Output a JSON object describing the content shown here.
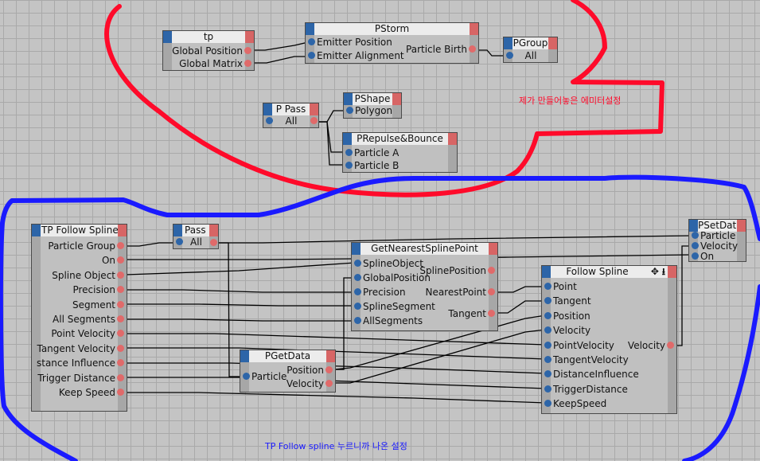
{
  "annotations": {
    "red_note": "제가 만들어놓은 에미터설정",
    "blue_note": "TP Follow spline 누르니까 나온 설정",
    "red_color": "#ff0a2a",
    "blue_color": "#1a1aff"
  },
  "colors": {
    "input_port": "#2d65a8",
    "output_port": "#e06a6a",
    "title_bg": "#ececec",
    "node_bg": "#c0c0c0",
    "canvas_bg": "#c4c4c4"
  },
  "nodes": {
    "tp": {
      "title": "tp",
      "outputs": [
        "Global Position",
        "Global Matrix"
      ]
    },
    "pstorm": {
      "title": "PStorm",
      "inputs": [
        "Emitter Position",
        "Emitter Alignment"
      ],
      "outputs": [
        "Particle Birth"
      ]
    },
    "pgroup": {
      "title": "PGroup",
      "inputs": [
        "All"
      ]
    },
    "ppass1": {
      "title": "P Pass",
      "inputs": [
        "All"
      ]
    },
    "pshape": {
      "title": "PShape",
      "inputs": [
        "Polygon"
      ]
    },
    "prepulse": {
      "title": "PRepulse&Bounce",
      "inputs": [
        "Particle A",
        "Particle B"
      ]
    },
    "tpfollow": {
      "title": "TP Follow Spline",
      "outputs": [
        "Particle Group",
        "On",
        "Spline Object",
        "Precision",
        "Segment",
        "All Segments",
        "Point Velocity",
        "Tangent Velocity",
        "stance Influence",
        "Trigger Distance",
        "Keep Speed"
      ]
    },
    "ppass2": {
      "title": "P Pass",
      "inputs": [
        "All"
      ]
    },
    "getnearest": {
      "title": "GetNearestSplinePoint",
      "inputs": [
        "SplineObject",
        "GlobalPosition",
        "Precision",
        "SplineSegment",
        "AllSegments"
      ],
      "outputs": [
        "SplinePosition",
        "NearestPoint",
        "Tangent"
      ]
    },
    "psetdata": {
      "title": "PSetData",
      "inputs": [
        "Particle",
        "Velocity",
        "On"
      ]
    },
    "followspline": {
      "title": "Follow Spline",
      "icons": [
        "move-icon",
        "arrow-down-icon"
      ],
      "icon_glyphs": [
        "✥",
        "⭳"
      ],
      "inputs": [
        "Point",
        "Tangent",
        "Position",
        "Velocity",
        "PointVelocity",
        "TangentVelocity",
        "DistanceInfluence",
        "TriggerDistance",
        "KeepSpeed"
      ],
      "outputs": [
        "Velocity"
      ]
    },
    "pgetdata": {
      "title": "PGetData",
      "inputs": [
        "Particle"
      ],
      "outputs": [
        "Position",
        "Velocity"
      ]
    }
  }
}
